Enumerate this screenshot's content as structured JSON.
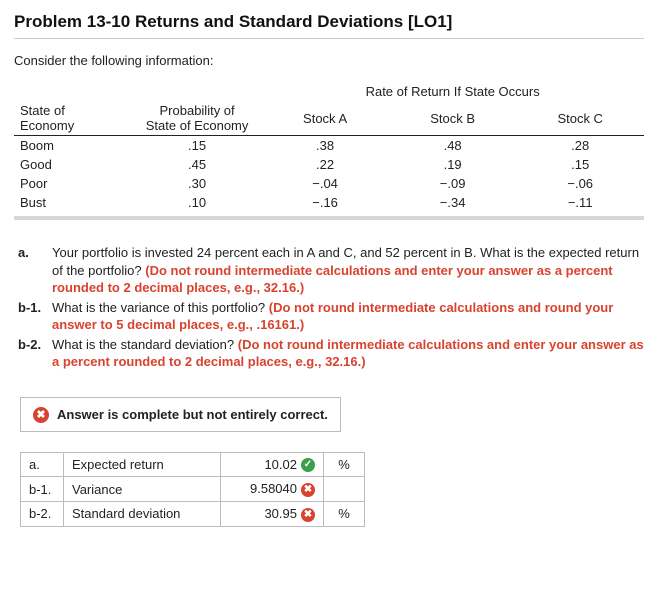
{
  "title": "Problem 13-10 Returns and Standard Deviations [LO1]",
  "intro": "Consider the following information:",
  "table": {
    "super_header": "Rate of Return If State Occurs",
    "headers": {
      "state": "State of Economy",
      "prob": "Probability of State of Economy",
      "stockA": "Stock A",
      "stockB": "Stock B",
      "stockC": "Stock C"
    },
    "rows": [
      {
        "state": "Boom",
        "prob": ".15",
        "a": ".38",
        "b": ".48",
        "c": ".28"
      },
      {
        "state": "Good",
        "prob": ".45",
        "a": ".22",
        "b": ".19",
        "c": ".15"
      },
      {
        "state": "Poor",
        "prob": ".30",
        "a": "−.04",
        "b": "−.09",
        "c": "−.06"
      },
      {
        "state": "Bust",
        "prob": ".10",
        "a": "−.16",
        "b": "−.34",
        "c": "−.11"
      }
    ]
  },
  "questions": {
    "a": {
      "label": "a.",
      "plain": "Your portfolio is invested 24 percent each in A and C, and 52 percent in B. What is the expected return of the portfolio? ",
      "red": "(Do not round intermediate calculations and enter your answer as a percent rounded to 2 decimal places, e.g., 32.16.)"
    },
    "b1": {
      "label": "b-1.",
      "plain": "What is the variance of this portfolio? ",
      "red": "(Do not round intermediate calculations and round your answer to 5 decimal places, e.g., .16161.)"
    },
    "b2": {
      "label": "b-2.",
      "plain": "What is the standard deviation? ",
      "red": "(Do not round intermediate calculations and enter your answer as a percent rounded to 2 decimal places, e.g., 32.16.)"
    }
  },
  "feedback": {
    "icon": "✖",
    "text": "Answer is complete but not entirely correct."
  },
  "answers": {
    "rows": [
      {
        "lab": "a.",
        "desc": "Expected return",
        "val": "10.02",
        "mark": "ok",
        "unit": "%"
      },
      {
        "lab": "b-1.",
        "desc": "Variance",
        "val": "9.58040",
        "mark": "bad",
        "unit": ""
      },
      {
        "lab": "b-2.",
        "desc": "Standard deviation",
        "val": "30.95",
        "mark": "bad",
        "unit": "%"
      }
    ]
  },
  "marks": {
    "ok": "✓",
    "bad": "✖"
  },
  "chart_data": {
    "type": "table",
    "title": "Rate of Return If State Occurs",
    "columns": [
      "State of Economy",
      "Probability of State of Economy",
      "Stock A",
      "Stock B",
      "Stock C"
    ],
    "rows": [
      [
        "Boom",
        0.15,
        0.38,
        0.48,
        0.28
      ],
      [
        "Good",
        0.45,
        0.22,
        0.19,
        0.15
      ],
      [
        "Poor",
        0.3,
        -0.04,
        -0.09,
        -0.06
      ],
      [
        "Bust",
        0.1,
        -0.16,
        -0.34,
        -0.11
      ]
    ]
  }
}
